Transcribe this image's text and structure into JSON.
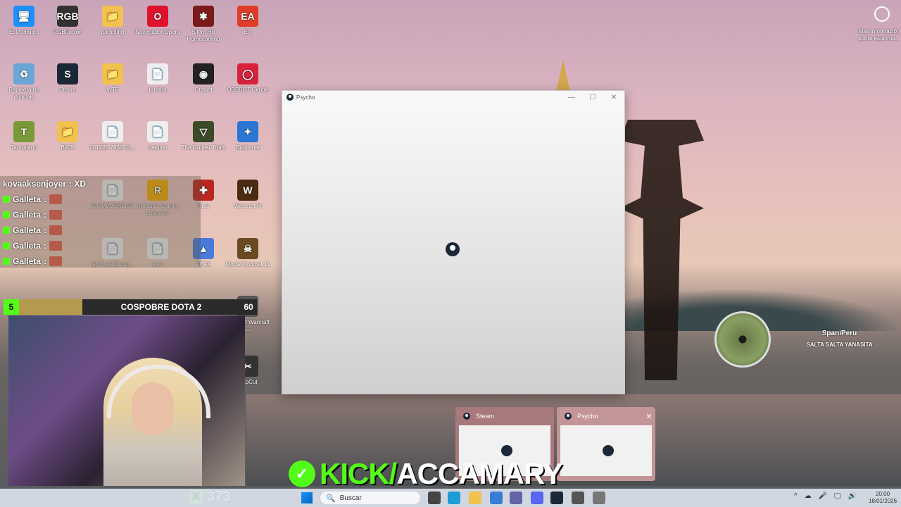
{
  "desktop": {
    "icons": [
      {
        "label": "Este equipo",
        "glyph": "🖥"
      },
      {
        "label": "RGBFusion",
        "glyph": "RGB"
      },
      {
        "label": "pampling",
        "glyph": "📁"
      },
      {
        "label": "Navegador Opera",
        "glyph": "O"
      },
      {
        "label": "Silent Hill Homecoming",
        "glyph": "✱"
      },
      {
        "label": "EA",
        "glyph": "EA"
      },
      {
        "label": "Papelera de reciclaje",
        "glyph": "♻"
      },
      {
        "label": "Steam",
        "glyph": "S"
      },
      {
        "label": "WTF",
        "glyph": "📁"
      },
      {
        "label": "prueba",
        "glyph": "📄"
      },
      {
        "label": "Outlast",
        "glyph": "◉"
      },
      {
        "label": "OBSBOT Center",
        "glyph": "◯"
      },
      {
        "label": "Tarmaland",
        "glyph": "T"
      },
      {
        "label": "BIOS",
        "glyph": "📁"
      },
      {
        "label": "061222-7968-01...",
        "glyph": "📄"
      },
      {
        "label": "readme",
        "glyph": "📄"
      },
      {
        "label": "The Outlast Trials",
        "glyph": "▽"
      },
      {
        "label": "Battle.net",
        "glyph": "✦"
      },
      {
        "label": "B45M0USHEIO3",
        "glyph": "📄"
      },
      {
        "label": "Rockstar Games Launcher",
        "glyph": "R"
      },
      {
        "label": "Rust",
        "glyph": "✚"
      },
      {
        "label": "Warcraft III",
        "glyph": "W"
      },
      {
        "label": "PEAK",
        "glyph": "▲"
      },
      {
        "label": "Mortal Kombat 11",
        "glyph": "☠"
      },
      {
        "label": "GHCrashDump...",
        "glyph": "📄"
      },
      {
        "label": "serv",
        "glyph": "📄"
      },
      {
        "label": "World of Warcraft ...",
        "glyph": "⚙"
      },
      {
        "label": "CapCut",
        "glyph": "✂"
      }
    ],
    "info_text": "Más información sobre esta ima..."
  },
  "chat": {
    "messages": [
      {
        "user": "kovaaksenjoyer",
        "text": ": XD"
      },
      {
        "user": "Galleta",
        "text": ":"
      },
      {
        "user": "Galleta",
        "text": ":"
      },
      {
        "user": "Galleta",
        "text": ":"
      },
      {
        "user": "Galleta",
        "text": ":"
      },
      {
        "user": "Galleta",
        "text": ":"
      }
    ]
  },
  "goal": {
    "start": "5",
    "title": "COSPOBRE DOTA 2",
    "count": "60"
  },
  "kick": {
    "viewers": "373",
    "prefix": "KICK/",
    "channel": "ACCAMARY",
    "k_glyph": "K",
    "check": "✓"
  },
  "window": {
    "title": "Psycho",
    "min": "—",
    "max": "☐",
    "close": "✕"
  },
  "previews": [
    {
      "title": "Steam",
      "close": ""
    },
    {
      "title": "Psycho",
      "close": "✕"
    }
  ],
  "notification": {
    "name": "SpaniPeru",
    "message": "SALTA SALTA YANASITA"
  },
  "taskbar": {
    "search_placeholder": "Buscar",
    "search_glyph": "🔍",
    "tray_glyphs": [
      "^",
      "☁",
      "🎤",
      "🖵",
      "🔊"
    ],
    "time": "20:00",
    "date": "18/01/2026"
  },
  "colors": {
    "kick_green": "#53fc18",
    "steam_dark": "#1b2838"
  }
}
